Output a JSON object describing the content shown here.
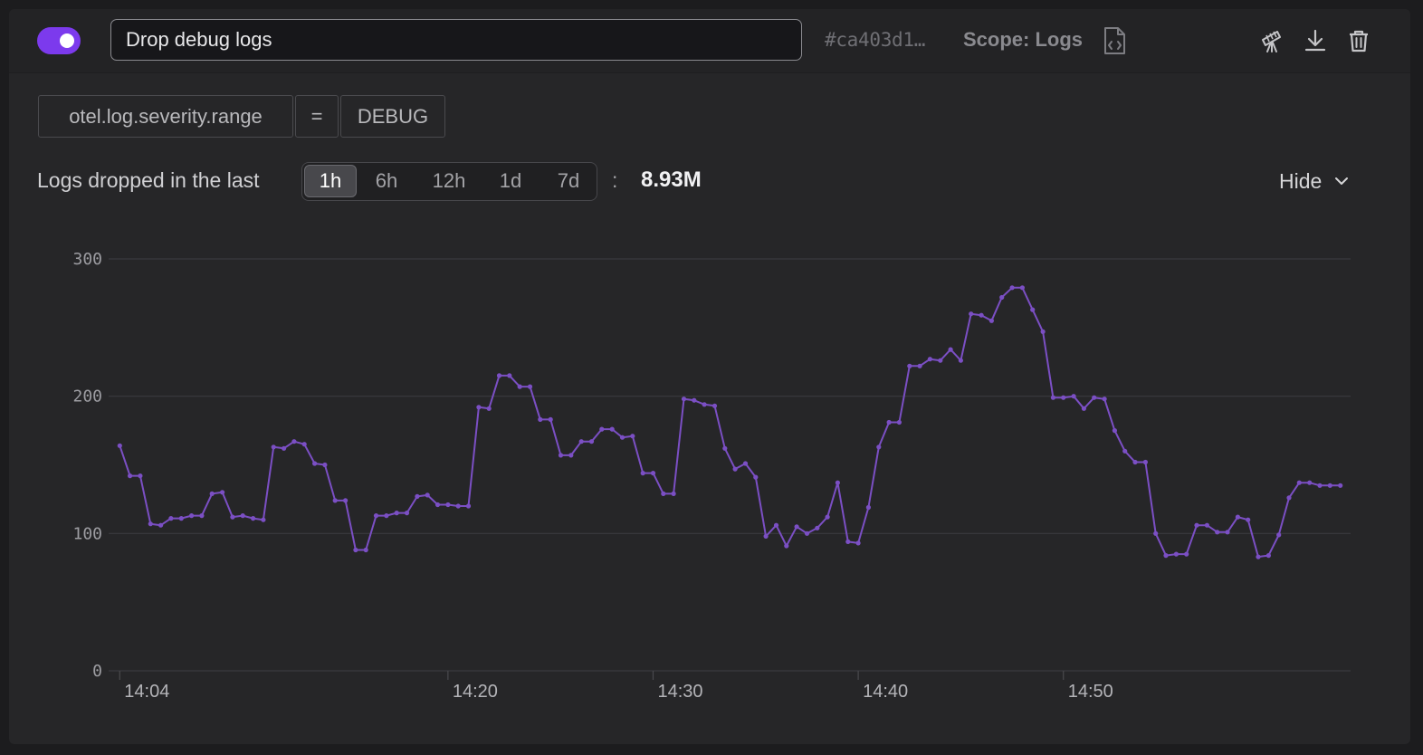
{
  "rule": {
    "enabled": true,
    "name": "Drop debug logs",
    "id": "#ca403d1…",
    "scope_label": "Scope: Logs"
  },
  "icons": {
    "scope": "code-file-icon",
    "telescope": "telescope-icon",
    "download": "download-icon",
    "delete": "trash-icon"
  },
  "filter": {
    "field": "otel.log.severity.range",
    "operator": "=",
    "value": "DEBUG"
  },
  "stats": {
    "label": "Logs dropped in the last",
    "ranges": [
      "1h",
      "6h",
      "12h",
      "1d",
      "7d"
    ],
    "selected_range": "1h",
    "separator": ":",
    "total": "8.93M",
    "hide_label": "Hide"
  },
  "colors": {
    "accent": "#7c3aed",
    "series": "#7b4fc4"
  },
  "chart_data": {
    "type": "line",
    "title": "",
    "xlabel": "",
    "ylabel": "",
    "ylim": [
      0,
      300
    ],
    "yticks": [
      0,
      100,
      200,
      300
    ],
    "xlim": [
      "14:04",
      "14:63"
    ],
    "xticks": [
      "14:04",
      "14:20",
      "14:30",
      "14:40",
      "14:50"
    ],
    "grid": true,
    "series": [
      {
        "values": [
          [
            240,
            164
          ],
          [
            270,
            142
          ],
          [
            300,
            142
          ],
          [
            330,
            107
          ],
          [
            360,
            106
          ],
          [
            390,
            111
          ],
          [
            420,
            111
          ],
          [
            450,
            113
          ],
          [
            480,
            113
          ],
          [
            510,
            129
          ],
          [
            540,
            130
          ],
          [
            570,
            112
          ],
          [
            600,
            113
          ],
          [
            630,
            111
          ],
          [
            660,
            110
          ],
          [
            690,
            163
          ],
          [
            720,
            162
          ],
          [
            750,
            167
          ],
          [
            780,
            165
          ],
          [
            810,
            151
          ],
          [
            840,
            150
          ],
          [
            870,
            124
          ],
          [
            900,
            124
          ],
          [
            930,
            88
          ],
          [
            960,
            88
          ],
          [
            990,
            113
          ],
          [
            1020,
            113
          ],
          [
            1050,
            115
          ],
          [
            1080,
            115
          ],
          [
            1110,
            127
          ],
          [
            1140,
            128
          ],
          [
            1170,
            121
          ],
          [
            1200,
            121
          ],
          [
            1230,
            120
          ],
          [
            1260,
            120
          ],
          [
            1290,
            192
          ],
          [
            1320,
            191
          ],
          [
            1350,
            215
          ],
          [
            1380,
            215
          ],
          [
            1410,
            207
          ],
          [
            1440,
            207
          ],
          [
            1470,
            183
          ],
          [
            1500,
            183
          ],
          [
            1530,
            157
          ],
          [
            1560,
            157
          ],
          [
            1590,
            167
          ],
          [
            1620,
            167
          ],
          [
            1650,
            176
          ],
          [
            1680,
            176
          ],
          [
            1710,
            170
          ],
          [
            1740,
            171
          ],
          [
            1770,
            144
          ],
          [
            1800,
            144
          ],
          [
            1830,
            129
          ],
          [
            1860,
            129
          ],
          [
            1890,
            198
          ],
          [
            1920,
            197
          ],
          [
            1950,
            194
          ],
          [
            1980,
            193
          ],
          [
            2010,
            162
          ],
          [
            2040,
            147
          ],
          [
            2070,
            151
          ],
          [
            2100,
            141
          ],
          [
            2130,
            98
          ],
          [
            2160,
            106
          ],
          [
            2190,
            91
          ],
          [
            2220,
            105
          ],
          [
            2250,
            100
          ],
          [
            2280,
            104
          ],
          [
            2310,
            112
          ],
          [
            2340,
            137
          ],
          [
            2370,
            94
          ],
          [
            2400,
            93
          ],
          [
            2430,
            119
          ],
          [
            2460,
            163
          ],
          [
            2490,
            181
          ],
          [
            2520,
            181
          ],
          [
            2550,
            222
          ],
          [
            2580,
            222
          ],
          [
            2610,
            227
          ],
          [
            2640,
            226
          ],
          [
            2670,
            234
          ],
          [
            2700,
            226
          ],
          [
            2730,
            260
          ],
          [
            2760,
            259
          ],
          [
            2790,
            255
          ],
          [
            2820,
            272
          ],
          [
            2850,
            279
          ],
          [
            2880,
            279
          ],
          [
            2910,
            263
          ],
          [
            2940,
            247
          ],
          [
            2970,
            199
          ],
          [
            3000,
            199
          ],
          [
            3030,
            200
          ],
          [
            3060,
            191
          ],
          [
            3090,
            199
          ],
          [
            3120,
            198
          ],
          [
            3150,
            175
          ],
          [
            3180,
            160
          ],
          [
            3210,
            152
          ],
          [
            3240,
            152
          ],
          [
            3270,
            100
          ],
          [
            3300,
            84
          ],
          [
            3330,
            85
          ],
          [
            3360,
            85
          ],
          [
            3390,
            106
          ],
          [
            3420,
            106
          ],
          [
            3450,
            101
          ],
          [
            3480,
            101
          ],
          [
            3510,
            112
          ],
          [
            3540,
            110
          ],
          [
            3570,
            83
          ],
          [
            3600,
            84
          ],
          [
            3630,
            99
          ],
          [
            3660,
            126
          ],
          [
            3690,
            137
          ],
          [
            3720,
            137
          ],
          [
            3750,
            135
          ],
          [
            3780,
            135
          ],
          [
            3810,
            135
          ]
        ]
      }
    ]
  }
}
